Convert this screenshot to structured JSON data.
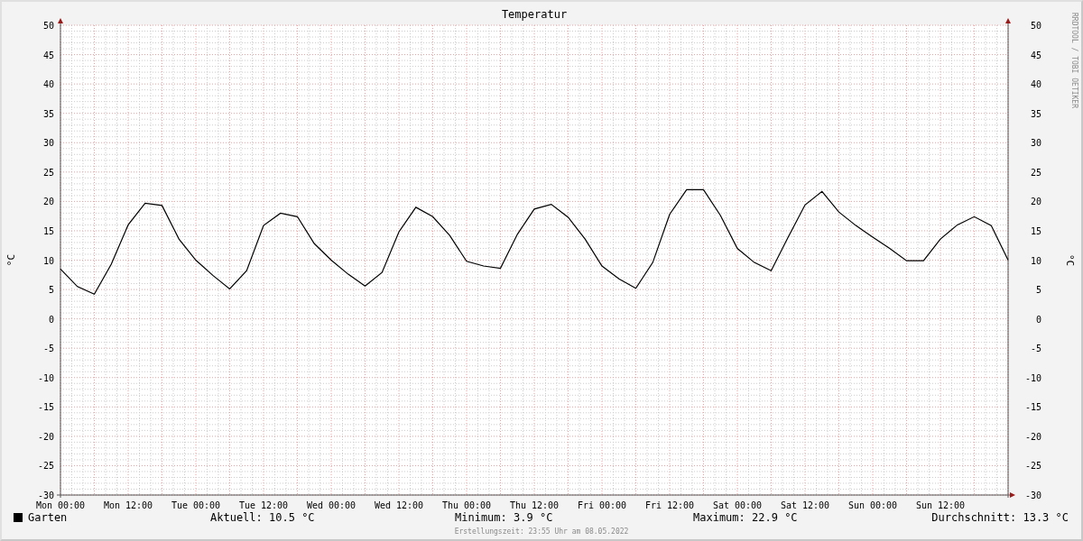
{
  "graph": {
    "chart_data": {
      "type": "line",
      "title": "Temperatur",
      "ylabel": "°C",
      "categories": [
        "Mon 00:00",
        null,
        null,
        null,
        "Mon 12:00",
        null,
        null,
        null,
        "Tue 00:00",
        null,
        null,
        null,
        "Tue 12:00",
        null,
        null,
        null,
        "Wed 00:00",
        null,
        null,
        null,
        "Wed 12:00",
        null,
        null,
        null,
        "Thu 00:00",
        null,
        null,
        null,
        "Thu 12:00",
        null,
        null,
        null,
        "Fri 00:00",
        null,
        null,
        null,
        "Fri 12:00",
        null,
        null,
        null,
        "Sat 00:00",
        null,
        null,
        null,
        "Sat 12:00",
        null,
        null,
        null,
        "Sun 00:00",
        null,
        null,
        null,
        "Sun 12:00",
        null,
        null,
        null,
        null
      ],
      "series": [
        {
          "name": "Garten",
          "color": "#000000",
          "values": [
            8.5,
            5.5,
            4.2,
            9.3,
            16.0,
            19.7,
            19.3,
            13.6,
            10.0,
            7.4,
            5.1,
            8.2,
            15.9,
            18.0,
            17.4,
            12.8,
            10.0,
            7.6,
            5.6,
            7.9,
            14.8,
            19.0,
            17.4,
            14.2,
            9.8,
            9.0,
            8.6,
            14.4,
            18.7,
            19.5,
            17.3,
            13.6,
            9.0,
            6.8,
            5.2,
            9.6,
            17.8,
            22.0,
            22.0,
            17.6,
            12.0,
            9.6,
            8.2,
            13.9,
            19.4,
            21.7,
            18.2,
            15.9,
            13.9,
            12.0,
            9.9,
            9.9,
            13.6,
            16.0,
            17.4,
            15.9,
            10.0
          ]
        }
      ],
      "grid": true,
      "ylim": [
        -30,
        50
      ],
      "yticks": [
        -30,
        -25,
        -20,
        -15,
        -10,
        -5,
        0,
        5,
        10,
        15,
        20,
        25,
        30,
        35,
        40,
        45,
        50
      ]
    },
    "right_axis_label": "°C",
    "right_axis_ticks": [
      "50",
      "45",
      "40",
      "35",
      "30",
      "25",
      "20",
      "15",
      "10",
      "5",
      "0",
      "-5",
      "-10",
      "-15",
      "-20",
      "-25",
      "-30"
    ],
    "watermark": "RRDTOOL / TOBI OETIKER"
  },
  "legend": {
    "current": "Aktuell: 10.5 °C",
    "minimum": "Minimum: 3.9 °C",
    "maximum": "Maximum: 22.9 °C",
    "average": "Durchschnitt: 13.3 °C"
  },
  "footer": "Erstellungszeit: 23:55 Uhr am 08.05.2022"
}
